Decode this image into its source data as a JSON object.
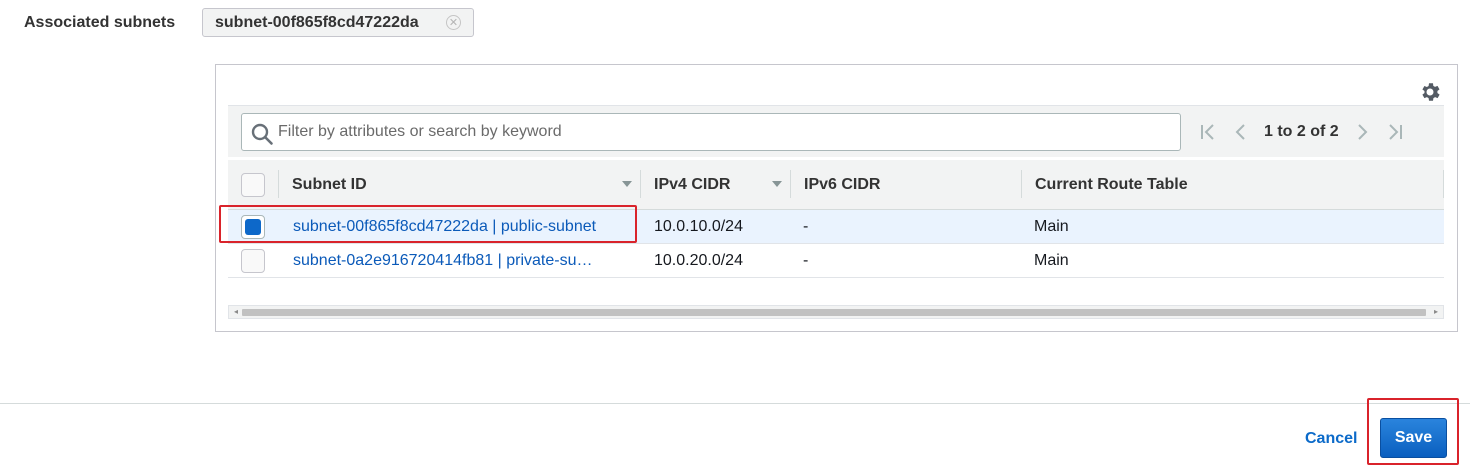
{
  "associated_subnets": {
    "label": "Associated subnets",
    "tokens": [
      {
        "label": "subnet-00f865f8cd47222da",
        "remove_icon": "close-circle-icon"
      }
    ]
  },
  "table": {
    "settings_icon": "gear-icon",
    "search": {
      "placeholder": "Filter by attributes or search by keyword",
      "value": "",
      "icon": "search-icon"
    },
    "pagination": {
      "text": "1 to 2 of 2",
      "first_icon": "first-page-icon",
      "prev_icon": "prev-page-icon",
      "next_icon": "next-page-icon",
      "last_icon": "last-page-icon"
    },
    "columns": [
      {
        "label": "Subnet ID",
        "sortable": true
      },
      {
        "label": "IPv4 CIDR",
        "sortable": true
      },
      {
        "label": "IPv6 CIDR",
        "sortable": false
      },
      {
        "label": "Current Route Table",
        "sortable": false
      }
    ],
    "rows": [
      {
        "checked": true,
        "subnet": "subnet-00f865f8cd47222da | public-subnet",
        "ipv4": "10.0.10.0/24",
        "ipv6": "-",
        "route_table": "Main"
      },
      {
        "checked": false,
        "subnet": "subnet-0a2e916720414fb81 | private-su…",
        "ipv4": "10.0.20.0/24",
        "ipv6": "-",
        "route_table": "Main"
      }
    ]
  },
  "footer": {
    "cancel_label": "Cancel",
    "save_label": "Save"
  },
  "colors": {
    "accent": "#0b5ab9",
    "primary_button": "#0f6ac9",
    "highlight_box": "#d9232b",
    "selected_row": "#eaf3fe"
  }
}
